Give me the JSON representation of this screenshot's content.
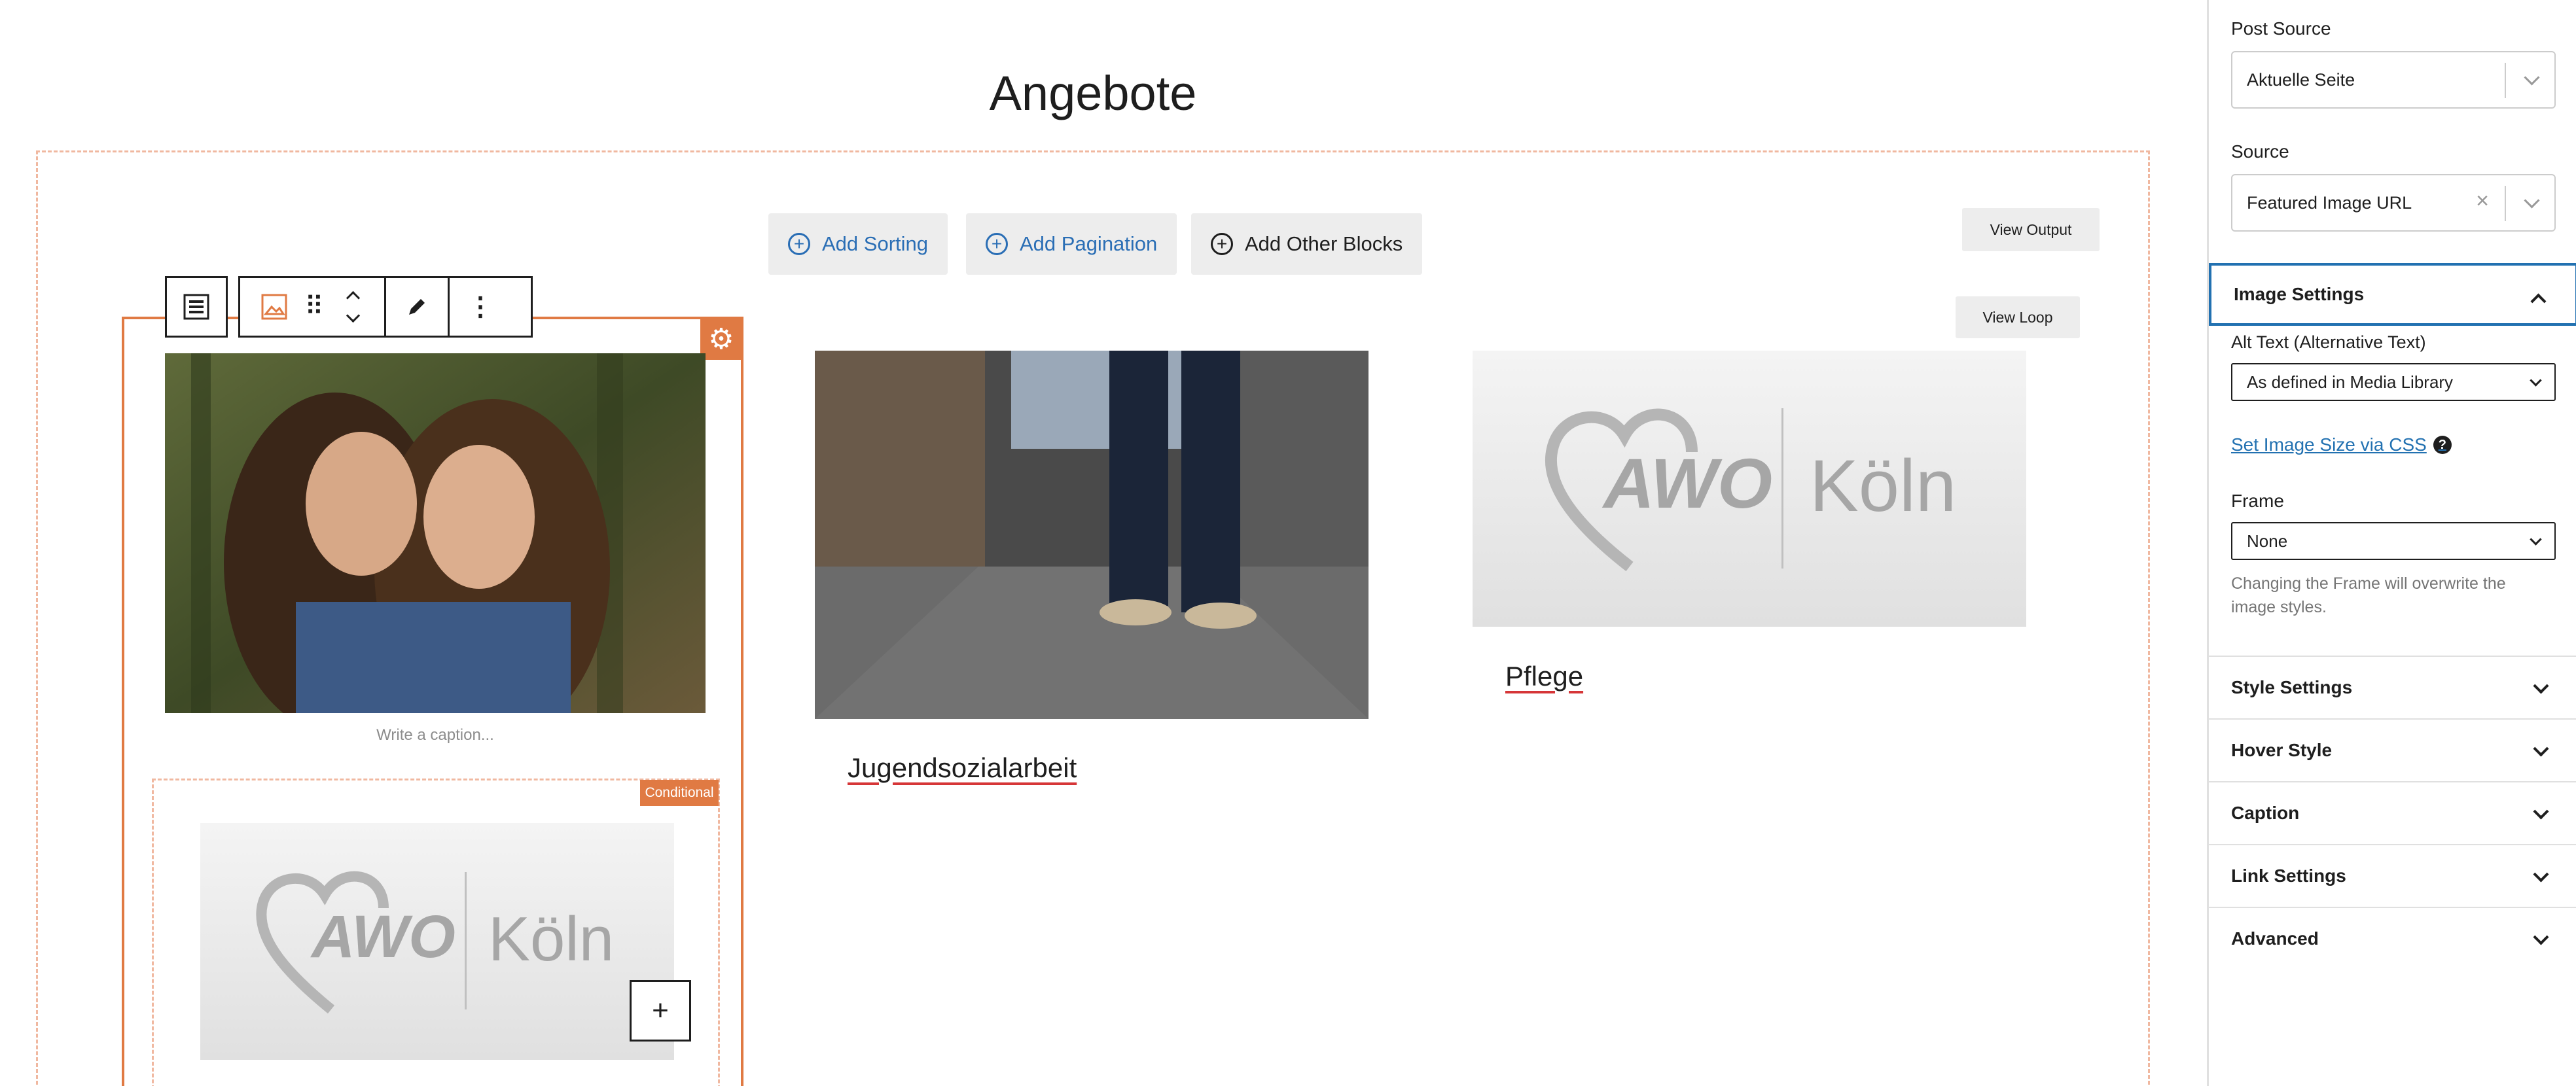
{
  "page": {
    "title": "Angebote",
    "add_sorting": "Add Sorting",
    "add_pagination": "Add Pagination",
    "add_other_blocks": "Add Other Blocks",
    "view_output": "View Output",
    "view_loop": "View Loop",
    "caption_placeholder": "Write a caption...",
    "conditional_badge": "Conditional",
    "logo": {
      "brand": "AWO",
      "city": "Köln"
    },
    "posts": [
      {
        "title": "Jugendsozialarbeit"
      },
      {
        "title": "Pflege"
      }
    ],
    "plus_symbol": "+"
  },
  "sidebar": {
    "post_source": {
      "label": "Post Source",
      "value": "Aktuelle Seite"
    },
    "source": {
      "label": "Source",
      "value": "Featured Image URL"
    },
    "image_settings": {
      "title": "Image Settings",
      "alt_text_label": "Alt Text (Alternative Text)",
      "alt_text_value": "As defined in Media Library",
      "size_link": "Set Image Size via CSS",
      "frame_label": "Frame",
      "frame_value": "None",
      "frame_help": "Changing the Frame will overwrite the image styles."
    },
    "sections": [
      "Style Settings",
      "Hover Style",
      "Caption",
      "Link Settings",
      "Advanced"
    ]
  },
  "colors": {
    "accent": "#e07a43",
    "link": "#2271b1",
    "blue_button_text": "#2a6eb5"
  }
}
